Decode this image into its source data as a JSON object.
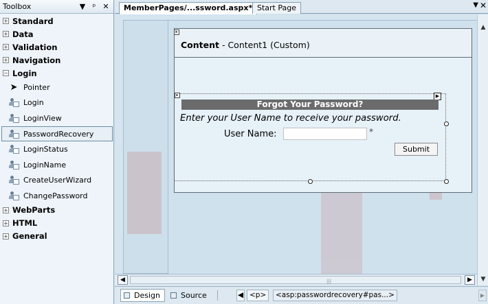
{
  "toolbox": {
    "title": "Toolbox",
    "categories_top": [
      {
        "label": "Standard",
        "sign": "+"
      },
      {
        "label": "Data",
        "sign": "+"
      },
      {
        "label": "Validation",
        "sign": "+"
      },
      {
        "label": "Navigation",
        "sign": "+"
      }
    ],
    "login_category": {
      "label": "Login",
      "sign": "−"
    },
    "login_items": [
      {
        "label": "Pointer",
        "icon": "pointer-icon"
      },
      {
        "label": "Login",
        "icon": "login-control-icon"
      },
      {
        "label": "LoginView",
        "icon": "loginview-control-icon"
      },
      {
        "label": "PasswordRecovery",
        "icon": "passwordrecovery-control-icon"
      },
      {
        "label": "LoginStatus",
        "icon": "loginstatus-control-icon"
      },
      {
        "label": "LoginName",
        "icon": "loginname-control-icon"
      },
      {
        "label": "CreateUserWizard",
        "icon": "createuserwizard-control-icon"
      },
      {
        "label": "ChangePassword",
        "icon": "changepassword-control-icon"
      }
    ],
    "categories_bottom": [
      {
        "label": "WebParts",
        "sign": "+"
      },
      {
        "label": "HTML",
        "sign": "+"
      },
      {
        "label": "General",
        "sign": "+"
      }
    ],
    "selected": "PasswordRecovery"
  },
  "editor": {
    "tabs": [
      {
        "label": "MemberPages/...ssword.aspx*",
        "active": true
      },
      {
        "label": "Start Page",
        "active": false
      }
    ],
    "content": {
      "title": "Content",
      "subtitle": " - Content1 (Custom)"
    },
    "password_recovery": {
      "title": "Forgot Your Password?",
      "instruction": "Enter your User Name to receive your password.",
      "user_name_label": "User Name:",
      "required_marker": "*",
      "submit_label": "Submit",
      "user_name_value": ""
    }
  },
  "statusbar": {
    "design_label": "Design",
    "source_label": "Source",
    "crumbs": [
      "<p>",
      "<asp:passwordrecovery#pas...>"
    ]
  },
  "colors": {
    "toolbox_bg": "#eef4f9",
    "canvas_bg": "#d5e4ef",
    "title_bar": "#6b6b6b",
    "watermark": "#c98f93"
  }
}
